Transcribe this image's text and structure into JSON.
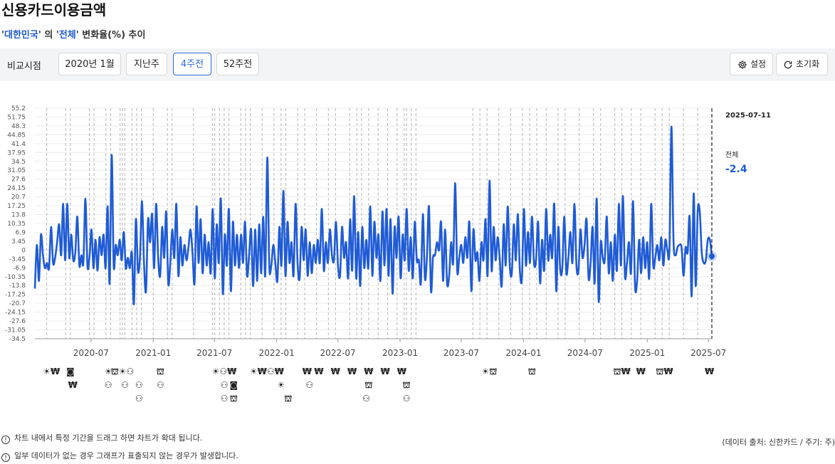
{
  "page": {
    "title": "신용카드이용금액"
  },
  "subtitle": {
    "q1": "'",
    "region": "대한민국",
    "q2": "' 의 '",
    "category": "전체",
    "q3": "' 변화율(%) 추이"
  },
  "toolbar": {
    "compare_label": "비교시점",
    "buttons": [
      "2020년 1월",
      "지난주",
      "4주전",
      "52주전"
    ],
    "active_index": 2,
    "settings_label": "설정",
    "reset_label": "초기화"
  },
  "side_panel": {
    "date": "2025-07-11",
    "series_name": "전체",
    "value": "-2.4"
  },
  "notes": [
    "차트 내에서 특정 기간을 드래그 하면 차트가 확대 됩니다.",
    "일부 데이터가 없는 경우 그래프가 표출되지 않는 경우가 발생합니다."
  ],
  "source": "(데이터 출처: 신한카드 / 주기: 주)",
  "colors": {
    "line": "#1f5bd6",
    "accent": "#2d6be0",
    "event_line": "#b5b5b5"
  },
  "chart_data": {
    "type": "line",
    "x_start": "2020-01-17",
    "x_end": "2025-07-11",
    "ylim": [
      -34.5,
      55.2
    ],
    "y_ticks": [
      "55.2",
      "51.75",
      "48.3",
      "44.85",
      "41.4",
      "37.95",
      "34.5",
      "31.05",
      "27.6",
      "24.15",
      "20.7",
      "17.25",
      "13.8",
      "10.35",
      "6.9",
      "3.45",
      "0",
      "-3.45",
      "-6.9",
      "-10.35",
      "-13.8",
      "-17.25",
      "-20.7",
      "-24.15",
      "-27.6",
      "-31.05",
      "-34.5"
    ],
    "x_ticks": [
      {
        "label": "2020-07",
        "date": "2020-07-01"
      },
      {
        "label": "2021-01",
        "date": "2021-01-01"
      },
      {
        "label": "2021-07",
        "date": "2021-07-01"
      },
      {
        "label": "2022-01",
        "date": "2022-01-01"
      },
      {
        "label": "2022-07",
        "date": "2022-07-01"
      },
      {
        "label": "2023-01",
        "date": "2023-01-01"
      },
      {
        "label": "2023-07",
        "date": "2023-07-01"
      },
      {
        "label": "2024-01",
        "date": "2024-01-01"
      },
      {
        "label": "2024-07",
        "date": "2024-07-01"
      },
      {
        "label": "2025-01",
        "date": "2025-01-01"
      },
      {
        "label": "2025-07",
        "date": "2025-07-01"
      }
    ],
    "grid": true,
    "series": [
      {
        "name": "전체",
        "values": [
          -15,
          2,
          -12,
          6,
          -2,
          -7,
          -5,
          -7,
          9,
          -5,
          -3,
          3,
          10,
          -2,
          18,
          -4,
          18,
          -3,
          6,
          -4,
          -1,
          13,
          -6,
          -2,
          -5,
          20,
          -6,
          -3,
          8,
          -7,
          4,
          -8,
          5,
          -2,
          6,
          -7,
          17,
          -13,
          37,
          -6,
          2,
          -2,
          4,
          -4,
          7,
          -7,
          -3,
          -7,
          -1,
          -21,
          12,
          -8,
          -3,
          19,
          -5,
          -16,
          12,
          3,
          14,
          -7,
          18,
          -3,
          -10,
          9,
          -3,
          15,
          -13,
          -5,
          8,
          -3,
          18,
          -10,
          5,
          -6,
          2,
          -4,
          1,
          8,
          -1,
          -13,
          17,
          -5,
          12,
          -9,
          6,
          -6,
          3,
          -9,
          16,
          -11,
          10,
          -5,
          20,
          -17,
          6,
          -6,
          16,
          -16,
          11,
          -6,
          6,
          -7,
          6,
          -5,
          11,
          -10,
          -2,
          8,
          -14,
          8,
          -12,
          10,
          -9,
          13,
          -10,
          36,
          -6,
          -6,
          2,
          -5,
          -12,
          9,
          -6,
          23,
          -10,
          11,
          -5,
          3,
          -10,
          18,
          -5,
          -11,
          9,
          -4,
          8,
          -10,
          3,
          -9,
          2,
          -5,
          4,
          -5,
          16,
          -8,
          3,
          -5,
          8,
          -2,
          -4,
          11,
          -6,
          -10,
          9,
          -3,
          3,
          -11,
          12,
          -8,
          21,
          -11,
          7,
          -14,
          9,
          -7,
          4,
          -7,
          17,
          -10,
          11,
          -3,
          6,
          -12,
          15,
          -6,
          16,
          -10,
          12,
          -17,
          9,
          -3,
          13,
          -11,
          6,
          -4,
          16,
          -8,
          5,
          -11,
          11,
          -4,
          -4,
          -13,
          14,
          -11,
          -3,
          17,
          -16,
          -3,
          -2,
          3,
          0,
          11,
          -12,
          8,
          -13,
          -10,
          3,
          -5,
          26,
          -8,
          -3,
          2,
          -5,
          5,
          -3,
          11,
          -16,
          8,
          -4,
          -1,
          -12,
          3,
          -4,
          12,
          -10,
          27,
          -8,
          9,
          -4,
          5,
          -3,
          -14,
          10,
          -6,
          17,
          -6,
          -9,
          10,
          -4,
          14,
          -8,
          -11,
          16,
          -6,
          7,
          -5,
          13,
          -5,
          -4,
          11,
          -13,
          4,
          -8,
          16,
          -4,
          6,
          -3,
          18,
          -16,
          9,
          -8,
          -7,
          13,
          -9,
          -3,
          7,
          -5,
          18,
          -6,
          -8,
          8,
          -3,
          2,
          12,
          -11,
          -5,
          9,
          -13,
          20,
          -20,
          3,
          -3,
          -4,
          13,
          -9,
          3,
          -12,
          6,
          -8,
          18,
          -6,
          21,
          -10,
          -5,
          3,
          -9,
          19,
          -14,
          -12,
          4,
          -9,
          5,
          -7,
          3,
          -11,
          18,
          -6,
          -3,
          2,
          -4,
          5,
          -6,
          4,
          0,
          0,
          48,
          4,
          -2,
          1,
          2,
          1,
          -10,
          1,
          -1,
          13,
          -18,
          22,
          -14,
          15,
          15,
          -1,
          -5,
          -4,
          4,
          4,
          -2.4
        ]
      }
    ],
    "event_dates": [
      "2020-02-21",
      "2020-04-17",
      "2020-05-01",
      "2020-06-26",
      "2020-07-10",
      "2020-08-14",
      "2020-08-28",
      "2020-09-25",
      "2020-10-02",
      "2020-10-09",
      "2020-10-30",
      "2020-11-13",
      "2020-11-27",
      "2021-01-01",
      "2021-02-12",
      "2021-02-26",
      "2021-04-30",
      "2021-06-25",
      "2021-07-02",
      "2021-07-16",
      "2021-07-30",
      "2021-08-13",
      "2021-09-17",
      "2021-10-01",
      "2021-10-15",
      "2021-11-19",
      "2021-12-24",
      "2022-01-14",
      "2022-01-28",
      "2022-03-04",
      "2022-03-25",
      "2022-04-29",
      "2022-06-03",
      "2022-06-24",
      "2022-08-05",
      "2022-08-26",
      "2022-09-09",
      "2022-09-30",
      "2022-10-28",
      "2022-11-25",
      "2022-12-23",
      "2023-01-13",
      "2023-01-20",
      "2023-02-03",
      "2023-02-17",
      "2023-08-04",
      "2023-08-25",
      "2023-09-15",
      "2023-10-20",
      "2023-11-24",
      "2023-12-29",
      "2024-01-19",
      "2024-02-09",
      "2024-03-08",
      "2024-04-12",
      "2024-05-03",
      "2024-06-14",
      "2024-07-26",
      "2024-08-16",
      "2024-09-27",
      "2024-10-18",
      "2024-11-15",
      "2024-12-13",
      "2025-01-24",
      "2025-02-14",
      "2025-03-07",
      "2025-04-18",
      "2025-05-30"
    ],
    "annotation_marks": [
      {
        "date": "2020-03-06",
        "row": 0,
        "text": "☀₩"
      },
      {
        "date": "2020-05-01",
        "row": 0,
        "text": "◙"
      },
      {
        "date": "2020-05-08",
        "row": 1,
        "text": "₩"
      },
      {
        "date": "2020-08-21",
        "row": 0,
        "text": "☀"
      },
      {
        "date": "2020-08-21",
        "row": 1,
        "text": "⚇"
      },
      {
        "date": "2020-10-02",
        "row": 0,
        "text": "⛫☀⚇"
      },
      {
        "date": "2020-10-09",
        "row": 1,
        "text": "⚇"
      },
      {
        "date": "2020-11-20",
        "row": 1,
        "text": "⚇"
      },
      {
        "date": "2020-11-20",
        "row": 2,
        "text": "⚇"
      },
      {
        "date": "2021-01-22",
        "row": 0,
        "text": "⛫"
      },
      {
        "date": "2021-01-22",
        "row": 1,
        "text": "⚇"
      },
      {
        "date": "2021-07-30",
        "row": 0,
        "text": "☀⚇₩"
      },
      {
        "date": "2021-07-30",
        "row": 1,
        "text": "⚇"
      },
      {
        "date": "2021-08-27",
        "row": 1,
        "text": "◙"
      },
      {
        "date": "2021-07-30",
        "row": 2,
        "text": "⚇"
      },
      {
        "date": "2021-08-27",
        "row": 2,
        "text": "⛫"
      },
      {
        "date": "2021-12-03",
        "row": 0,
        "text": "☀₩⚇₩"
      },
      {
        "date": "2022-01-14",
        "row": 1,
        "text": "☀"
      },
      {
        "date": "2022-02-04",
        "row": 2,
        "text": "⛫"
      },
      {
        "date": "2022-04-01",
        "row": 0,
        "text": "₩"
      },
      {
        "date": "2022-05-06",
        "row": 0,
        "text": "₩"
      },
      {
        "date": "2022-04-08",
        "row": 1,
        "text": "⚇"
      },
      {
        "date": "2022-06-24",
        "row": 0,
        "text": "₩"
      },
      {
        "date": "2022-08-12",
        "row": 0,
        "text": "₩"
      },
      {
        "date": "2022-09-30",
        "row": 0,
        "text": "₩"
      },
      {
        "date": "2022-09-30",
        "row": 1,
        "text": "⛫"
      },
      {
        "date": "2022-09-23",
        "row": 2,
        "text": "⚇"
      },
      {
        "date": "2022-11-18",
        "row": 0,
        "text": "₩"
      },
      {
        "date": "2023-01-06",
        "row": 0,
        "text": "₩"
      },
      {
        "date": "2023-01-20",
        "row": 1,
        "text": "⛫"
      },
      {
        "date": "2023-01-20",
        "row": 2,
        "text": "⚇"
      },
      {
        "date": "2023-09-22",
        "row": 0,
        "text": "☀⛫"
      },
      {
        "date": "2024-01-26",
        "row": 0,
        "text": "⛫"
      },
      {
        "date": "2024-10-18",
        "row": 0,
        "text": "⛫₩"
      },
      {
        "date": "2024-12-13",
        "row": 0,
        "text": "₩"
      },
      {
        "date": "2025-02-21",
        "row": 0,
        "text": "⛫₩"
      },
      {
        "date": "2025-07-04",
        "row": 0,
        "text": "₩"
      }
    ]
  }
}
